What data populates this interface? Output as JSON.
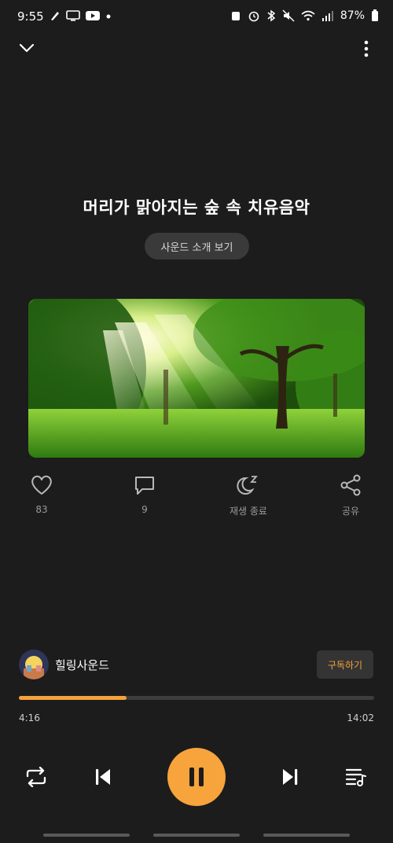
{
  "status_bar": {
    "time": "9:55",
    "battery": "87%"
  },
  "track": {
    "title": "머리가 맑아지는 숲 속 치유음악",
    "intro_label": "사운드 소개 보기"
  },
  "actions": [
    {
      "icon": "heart-icon",
      "label": "83"
    },
    {
      "icon": "comment-icon",
      "label": "9"
    },
    {
      "icon": "sleep-timer-icon",
      "label": "재생 종료"
    },
    {
      "icon": "share-icon",
      "label": "공유"
    }
  ],
  "channel": {
    "name": "힐링사운드",
    "subscribe_label": "구독하기"
  },
  "player": {
    "current_time": "4:16",
    "total_time": "14:02",
    "progress": 0.304
  },
  "colors": {
    "accent": "#f7a43c",
    "background": "#1c1c1c"
  }
}
